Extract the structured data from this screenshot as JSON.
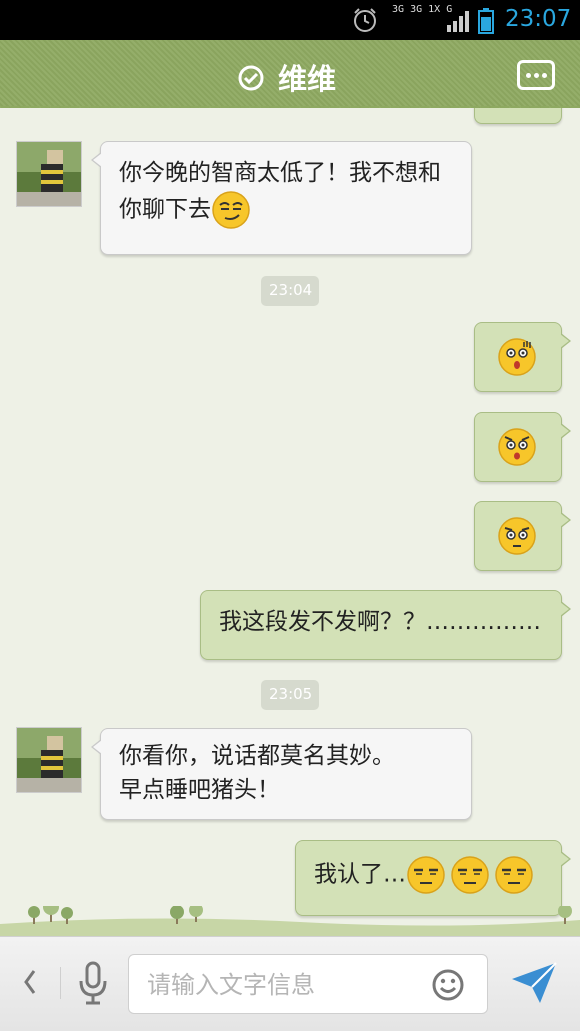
{
  "status_bar": {
    "network_labels": [
      "3G",
      "3G 1X",
      "G"
    ],
    "time": "23:07",
    "icons": [
      "alarm-icon",
      "signal-icon",
      "battery-icon"
    ],
    "time_color": "#2aa7df"
  },
  "header": {
    "title": "维维",
    "icons": [
      "check-circle-icon",
      "more-menu-icon"
    ],
    "background_color": "#8ea961"
  },
  "messages": [
    {
      "direction": "incoming",
      "text": "你今晚的智商太低了！我不想和你聊下去",
      "emojis": [
        "smug-face"
      ]
    },
    {
      "type": "timestamp",
      "text": "23:04"
    },
    {
      "direction": "outgoing",
      "text": "",
      "emojis": [
        "surprised-face"
      ]
    },
    {
      "direction": "outgoing",
      "text": "",
      "emojis": [
        "shocked-face"
      ]
    },
    {
      "direction": "outgoing",
      "text": "",
      "emojis": [
        "confused-face"
      ]
    },
    {
      "direction": "outgoing",
      "text": "我这段发不发啊？？……………",
      "emojis": []
    },
    {
      "type": "timestamp",
      "text": "23:05"
    },
    {
      "direction": "incoming",
      "text": "你看你，说话都莫名其妙。早点睡吧猪头！",
      "emojis": []
    },
    {
      "direction": "outgoing",
      "text": "我认了…",
      "emojis": [
        "annoyed-face",
        "annoyed-face",
        "annoyed-face"
      ]
    }
  ],
  "input_bar": {
    "placeholder": "请输入文字信息",
    "value": "",
    "icons": [
      "back-chevron-icon",
      "microphone-icon",
      "smiley-icon",
      "send-icon"
    ]
  },
  "colors": {
    "incoming_bubble": "#f6f6f6",
    "outgoing_bubble": "#d3e1b7",
    "chat_background": "#eef1e6"
  }
}
